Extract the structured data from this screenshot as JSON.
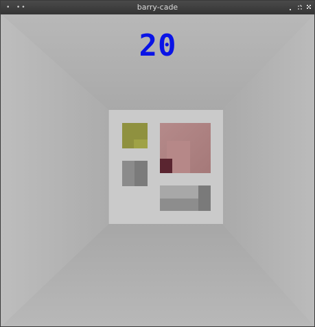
{
  "window": {
    "title": "barry-cade"
  },
  "game": {
    "score": "20",
    "score_color": "#0a14e6",
    "wall_color": "#b6b6b6",
    "back_panel_color": "#cacaca",
    "blocks": [
      {
        "name": "olive-block",
        "color": "#8f913f"
      },
      {
        "name": "red-block",
        "color": "#b48a8a"
      },
      {
        "name": "gray-block",
        "color": "#8b8b8b"
      },
      {
        "name": "gray-slab-block",
        "color": "#9d9d9d"
      }
    ]
  }
}
